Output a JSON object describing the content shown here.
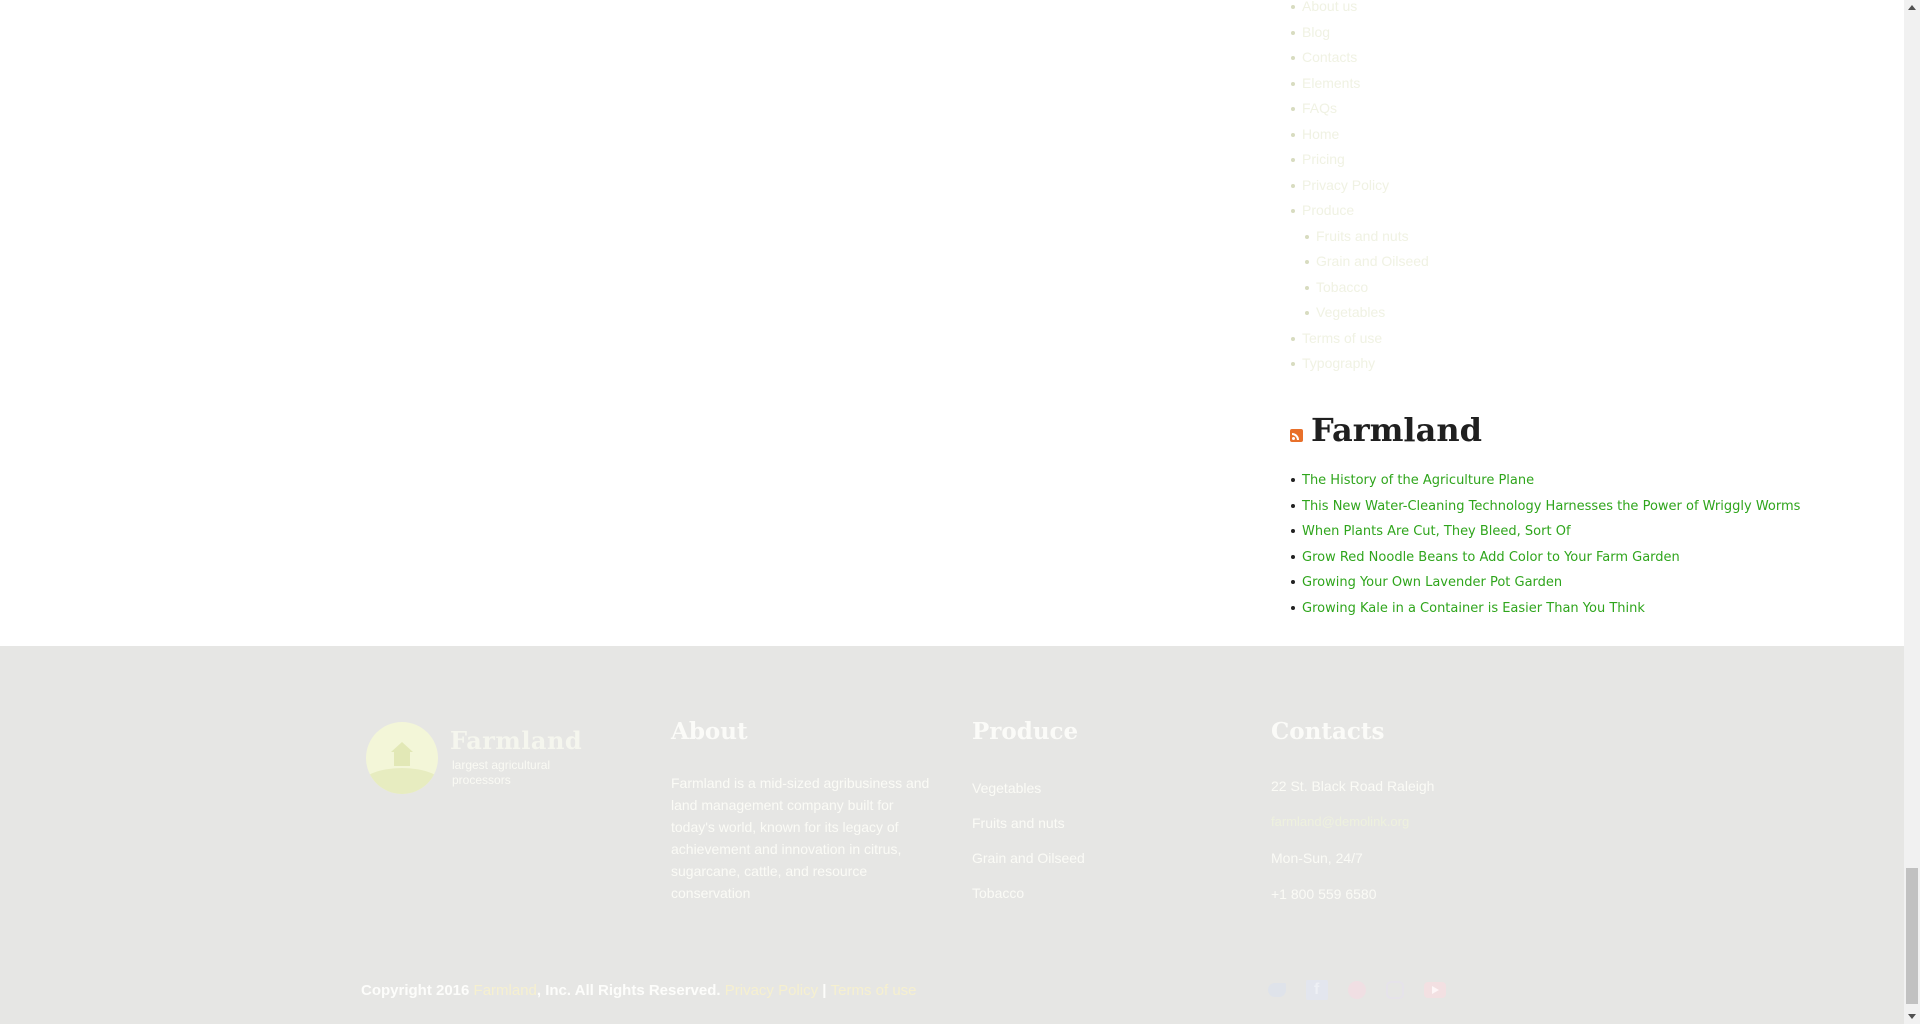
{
  "sidebar": {
    "pages": [
      {
        "label": "About us"
      },
      {
        "label": "Blog"
      },
      {
        "label": "Contacts"
      },
      {
        "label": "Elements"
      },
      {
        "label": "FAQs"
      },
      {
        "label": "Home"
      },
      {
        "label": "Pricing"
      },
      {
        "label": "Privacy Policy"
      },
      {
        "label": "Produce"
      }
    ],
    "produce_children": [
      {
        "label": "Fruits and nuts"
      },
      {
        "label": "Grain and Oilseed"
      },
      {
        "label": "Tobacco"
      },
      {
        "label": "Vegetables"
      }
    ],
    "pages_after": [
      {
        "label": "Terms of use"
      },
      {
        "label": "Typography"
      }
    ]
  },
  "rss": {
    "title": "Farmland",
    "icon": "rss-icon",
    "items": [
      {
        "label": "The History of the Agriculture Plane"
      },
      {
        "label": "This New Water-Cleaning Technology Harnesses the Power of Wriggly Worms"
      },
      {
        "label": "When Plants Are Cut, They Bleed, Sort Of"
      },
      {
        "label": "Grow Red Noodle Beans to Add Color to Your Farm Garden"
      },
      {
        "label": "Growing Your Own Lavender Pot Garden"
      },
      {
        "label": "Growing Kale in a Container is Easier Than You Think"
      }
    ],
    "link_color": "#2fa51c"
  },
  "footer": {
    "brand": {
      "name": "Farmland",
      "tagline": "largest agricultural processors"
    },
    "about": {
      "title": "About",
      "text": "Farmland is a mid-sized agribusiness and land management company built for today's world, known for its legacy of achievement and innovation in citrus, sugarcane, cattle, and resource conservation"
    },
    "produce": {
      "title": "Produce",
      "items": [
        "Vegetables",
        "Fruits and nuts",
        "Grain and Oilseed",
        "Tobacco"
      ]
    },
    "contacts": {
      "title": "Contacts",
      "address": "22 St. Black Road Raleigh",
      "email": "farmland@demolink.org",
      "hours": "Mon-Sun, 24/7",
      "phone": "+1 800 559 6580"
    },
    "copyright": {
      "prefix": "Copyright 2016 ",
      "brand_link": "Farmland",
      "middle": ", Inc. All Rights Reserved. ",
      "privacy_link": "Privacy Policy",
      "separator": " | ",
      "terms_link": "Terms of use"
    },
    "social": [
      "twitter-icon",
      "facebook-icon",
      "pinterest-icon",
      "instagram-icon",
      "youtube-icon"
    ],
    "background": "#e6e6e4"
  }
}
